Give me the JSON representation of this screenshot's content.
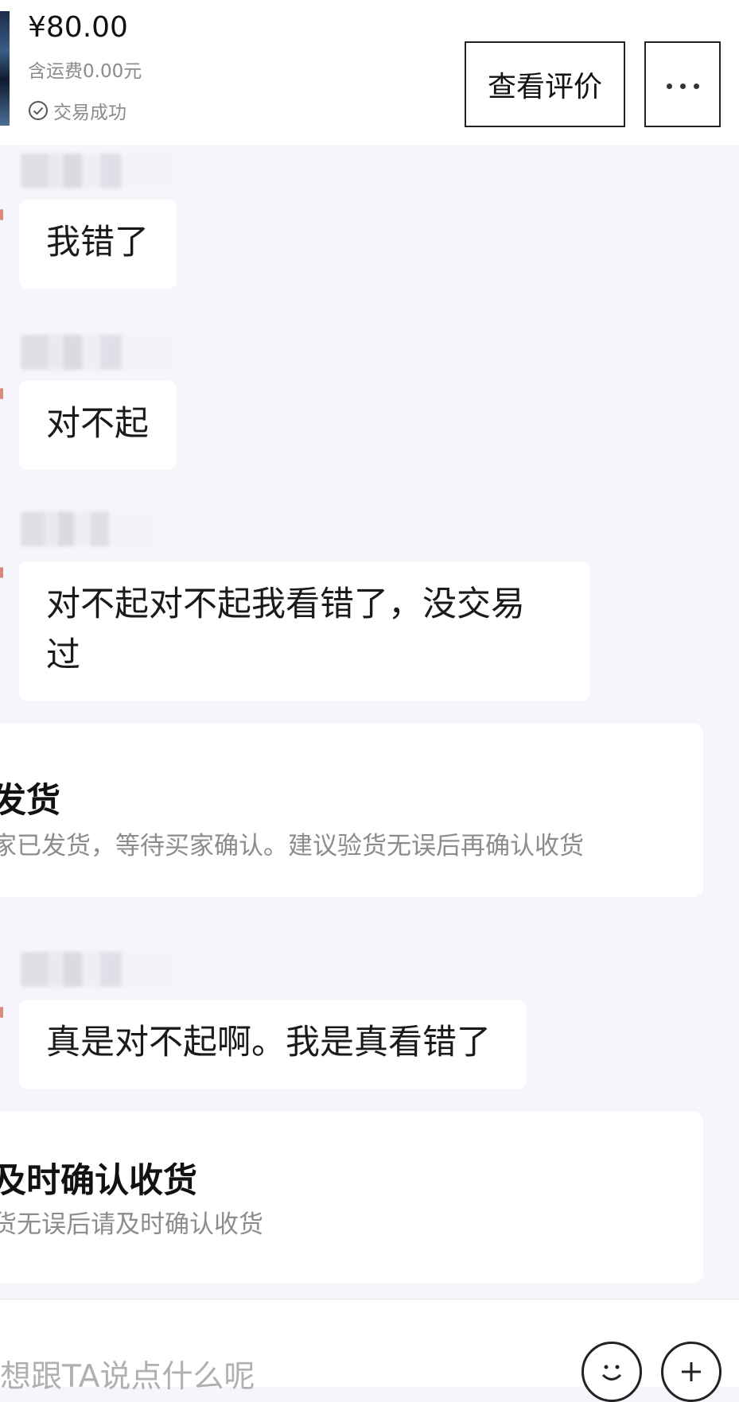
{
  "header": {
    "price": "¥80.00",
    "shipping": "含运费0.00元",
    "status": "交易成功",
    "review_button": "查看评价",
    "more_icon": "more-dots-icon",
    "status_icon": "check-circle-icon"
  },
  "messages": [
    {
      "text": "我错了"
    },
    {
      "text": "对不起"
    },
    {
      "text": "对不起对不起我看错了，没交易过"
    },
    {
      "text": "真是对不起啊。我是真看错了"
    }
  ],
  "cards": [
    {
      "title": "发货",
      "desc": "家已发货，等待买家确认。建议验货无误后再确认收货"
    },
    {
      "title": "及时确认收货",
      "desc": "货无误后请及时确认收货"
    }
  ],
  "input": {
    "placeholder": "想跟TA说点什么呢",
    "emoji_icon": "emoji-icon",
    "plus_icon": "plus-icon"
  },
  "colors": {
    "background": "#f5f5fb",
    "card": "#ffffff",
    "secondary_text": "#8c8c8c"
  }
}
